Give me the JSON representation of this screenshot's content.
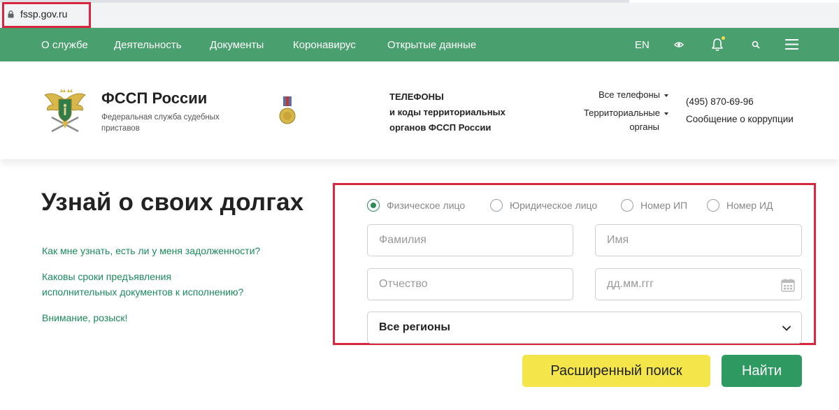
{
  "browser": {
    "url": "fssp.gov.ru"
  },
  "topnav": {
    "items": [
      {
        "label": "О службе"
      },
      {
        "label": "Деятельность"
      },
      {
        "label": "Документы"
      },
      {
        "label": "Коронавирус"
      },
      {
        "label": "Открытые данные"
      }
    ],
    "lang": "EN"
  },
  "header": {
    "org_title": "ФССП России",
    "org_subtitle": "Федеральная служба судебных приставов",
    "phones_line1": "ТЕЛЕФОНЫ",
    "phones_line2": "и коды территориальных",
    "phones_line3": "органов ФССП России",
    "all_phones": "Все телефоны",
    "territorial_line1": "Территориальные",
    "territorial_line2": "органы",
    "phone_number": "(495) 870-69-96",
    "corruption_report": "Сообщение о коррупции"
  },
  "main": {
    "title": "Узнай о своих долгах",
    "faq": [
      {
        "line1": "Как мне узнать, есть ли у меня задолженности?",
        "line2": ""
      },
      {
        "line1": "Каковы сроки предъявления",
        "line2": "исполнительных документов к исполнению?"
      },
      {
        "line1": "Внимание, розыск!",
        "line2": ""
      }
    ]
  },
  "search": {
    "radios": [
      {
        "label": "Физическое лицо",
        "checked": true
      },
      {
        "label": "Юридическое лицо",
        "checked": false
      },
      {
        "label": "Номер ИП",
        "checked": false
      },
      {
        "label": "Номер ИД",
        "checked": false
      }
    ],
    "surname_placeholder": "Фамилия",
    "name_placeholder": "Имя",
    "patronymic_placeholder": "Отчество",
    "birthdate_placeholder": "дд.мм.ггг",
    "region_value": "Все регионы",
    "advanced_button": "Расширенный поиск",
    "find_button": "Найти"
  },
  "colors": {
    "nav_green": "#4a9f6e",
    "link_green": "#1a8a5c",
    "button_green": "#2e9a62",
    "button_yellow": "#f3e54a",
    "highlight_red": "#d7263d"
  }
}
